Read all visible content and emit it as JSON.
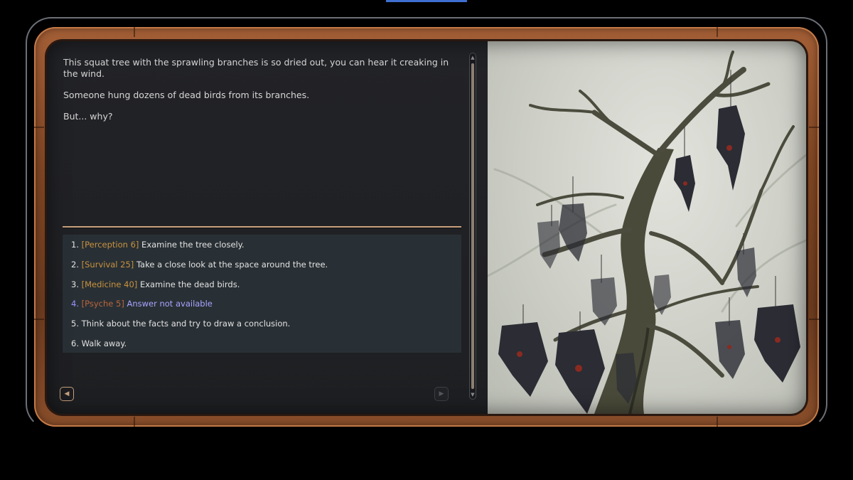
{
  "description": {
    "paragraphs": [
      "This squat tree with the sprawling branches is so dried out, you can hear it creaking in the wind.",
      "Someone hung dozens of dead birds from its branches.",
      "But... why?"
    ]
  },
  "options": [
    {
      "num": "1.",
      "skill": "[Perception 6]",
      "label": "Examine the tree closely.",
      "available": true
    },
    {
      "num": "2.",
      "skill": "[Survival 25]",
      "label": "Take a close look at the space around the tree.",
      "available": true
    },
    {
      "num": "3.",
      "skill": "[Medicine 40]",
      "label": "Examine the dead birds.",
      "available": true
    },
    {
      "num": "4.",
      "skill": "[Psyche 5]",
      "label": "Answer not available",
      "available": false
    },
    {
      "num": "5.",
      "skill": "",
      "label": "Think about the facts and try to draw a conclusion.",
      "available": true
    },
    {
      "num": "6.",
      "skill": "",
      "label": "Walk away.",
      "available": true
    }
  ],
  "icons": {
    "prev": "triangle-left-icon",
    "next": "triangle-right-icon",
    "scroll_up": "chevron-up-icon",
    "scroll_down": "chevron-down-icon"
  },
  "colors": {
    "skill_tag": "#c9913e",
    "unavailable": "#a8a4ff",
    "divider": "#c9a27f",
    "frame": "#8a4e2a"
  }
}
